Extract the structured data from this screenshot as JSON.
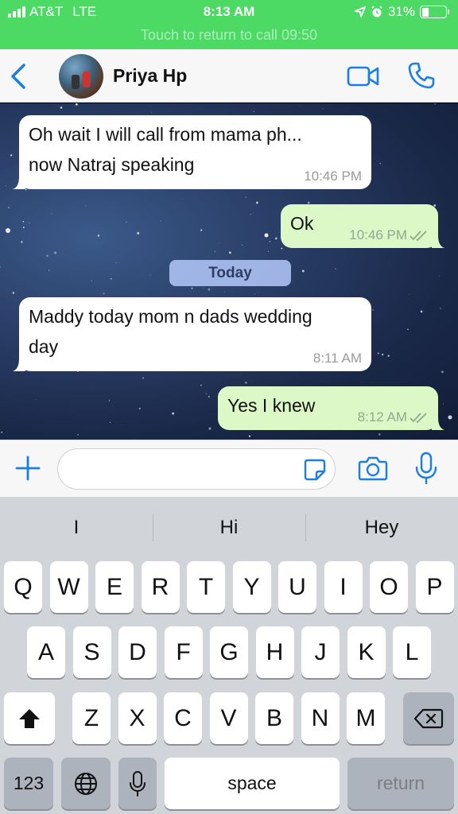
{
  "status_bar": {
    "carrier": "AT&T",
    "network": "LTE",
    "time": "8:13 AM",
    "battery": "31%",
    "battery_level": 0.31,
    "icons": [
      "signal-bars-icon",
      "location-arrow-icon",
      "alarm-icon",
      "battery-icon"
    ]
  },
  "call_banner": "Touch to return to call 09:50",
  "header": {
    "contact_name": "Priya Hp",
    "icons": [
      "back-chevron-icon",
      "video-call-icon",
      "phone-call-icon"
    ]
  },
  "messages": [
    {
      "direction": "incoming",
      "lines": [
        "Oh wait I will call from mama ph...",
        "now Natraj speaking"
      ],
      "time": "10:46 PM"
    },
    {
      "direction": "outgoing",
      "lines": [
        "Ok"
      ],
      "time": "10:46 PM",
      "read": true
    },
    {
      "direction": "incoming",
      "lines": [
        "Maddy today mom n dads wedding",
        "day"
      ],
      "time": "8:11 AM"
    },
    {
      "direction": "outgoing",
      "lines": [
        "Yes I knew"
      ],
      "time": "8:12 AM",
      "read": true
    }
  ],
  "date_separator": "Today",
  "input_bar": {
    "value": "",
    "icons": [
      "plus-icon",
      "sticker-icon",
      "camera-icon",
      "microphone-icon"
    ]
  },
  "keyboard": {
    "suggestions": [
      "I",
      "Hi",
      "Hey"
    ],
    "row1": [
      "Q",
      "W",
      "E",
      "R",
      "T",
      "Y",
      "U",
      "I",
      "O",
      "P"
    ],
    "row2": [
      "A",
      "S",
      "D",
      "F",
      "G",
      "H",
      "J",
      "K",
      "L"
    ],
    "row3": [
      "Z",
      "X",
      "C",
      "V",
      "B",
      "N",
      "M"
    ],
    "numbers_key": "123",
    "space_key": "space",
    "return_key": "return"
  },
  "colors": {
    "status_bar_bg": "#4cd964",
    "accent_blue": "#1a7ee6",
    "outgoing_bubble": "#dcf8c6",
    "incoming_bubble": "#ffffff",
    "keyboard_bg": "#d1d4d9"
  }
}
